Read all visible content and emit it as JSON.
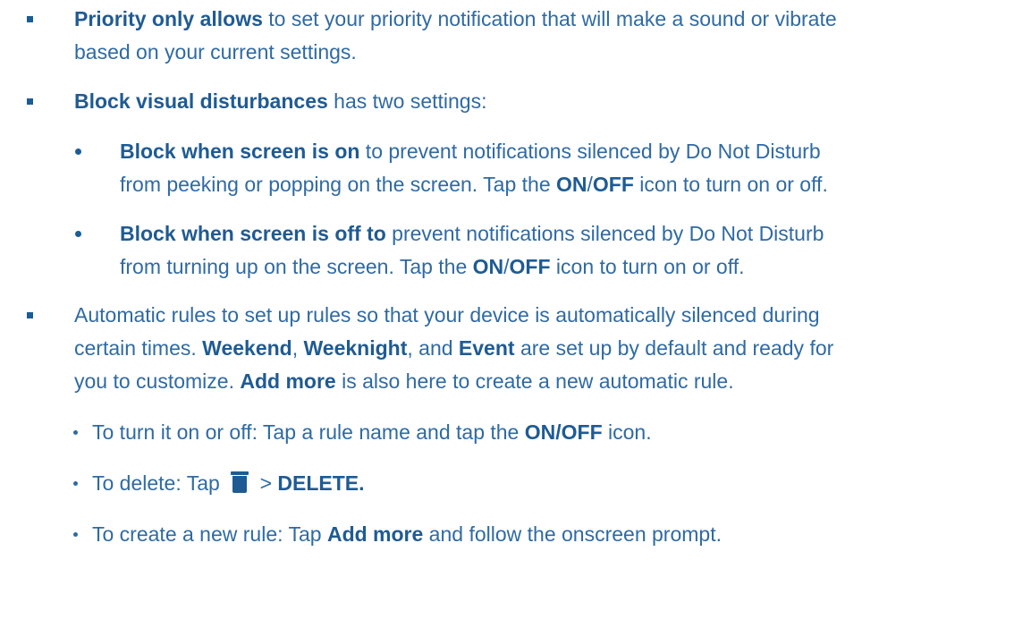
{
  "items": {
    "priority": {
      "bold": "Priority only allows",
      "rest": " to set your priority notification that will make a sound or vibrate",
      "line2": "based on your current settings."
    },
    "block_visual": {
      "bold": "Block visual disturbances",
      "rest": " has two settings:"
    },
    "block_on": {
      "bold": "Block when screen is on",
      "rest": " to prevent notifications silenced by Do Not Disturb",
      "line2_start": "from peeking or popping on the screen. Tap the ",
      "on": "ON",
      "slash": "/",
      "off": "OFF",
      "line2_end": " icon to turn on or off."
    },
    "block_off": {
      "bold": "Block when screen is off to",
      "rest": " prevent notifications silenced by Do Not Disturb",
      "line2_start": "from turning up on the screen. Tap the ",
      "on": "ON",
      "slash": "/",
      "off": "OFF",
      "line2_end": " icon to turn on or off."
    },
    "automatic": {
      "line1": "Automatic rules to set up rules so that your device is automatically silenced during",
      "line2_start": "certain times. ",
      "weekend": "Weekend",
      "comma1": ", ",
      "weeknight": "Weeknight",
      "and": ", and ",
      "event": "Event",
      "line2_end": " are set up by default and ready for",
      "line3_start": "you to customize. ",
      "add_more": "Add more",
      "line3_end": " is also here to create a new automatic rule."
    },
    "turn_on_off": {
      "start": "To turn it on or off: Tap a rule name and tap the ",
      "bold": "ON/OFF",
      "end": " icon."
    },
    "delete": {
      "start": "To delete: Tap ",
      "icon": "trash-icon",
      "mid": " > ",
      "bold": "DELETE."
    },
    "create": {
      "start": "To create a new rule: Tap ",
      "bold": "Add more",
      "end": " and follow the onscreen prompt."
    }
  },
  "colors": {
    "text": "#2f6aa3",
    "bold": "#1f5b93",
    "bullet": "#1a5d97"
  }
}
